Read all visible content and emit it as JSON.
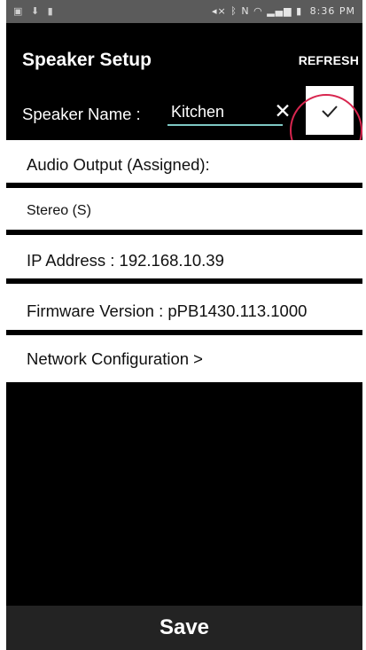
{
  "status_bar": {
    "left_icons": [
      "image-icon",
      "download-icon",
      "notification-icon"
    ],
    "right_icons": [
      "mute-icon",
      "bluetooth-icon",
      "nfc-icon",
      "wifi-icon",
      "signal-icon",
      "battery-icon"
    ],
    "time": "8:36 PM"
  },
  "header": {
    "title": "Speaker Setup",
    "refresh_label": "REFRESH"
  },
  "speaker_name": {
    "label": "Speaker Name :",
    "value": "Kitchen",
    "clear_glyph": "✕",
    "clear_icon": "close-icon",
    "confirm_icon": "checkmark-icon"
  },
  "settings": {
    "audio_output_label": "Audio Output (Assigned):",
    "audio_output_value": "Stereo (S)",
    "ip_address": "IP  Address : 192.168.10.39",
    "firmware": "Firmware  Version : pPB1430.113.1000",
    "network_config": "Network  Configuration >"
  },
  "footer": {
    "save_label": "Save"
  },
  "colors": {
    "accent_underline": "#7ec8c4",
    "highlight_ring": "#d8264f",
    "status_bar": "#5b5b5b",
    "save_bar": "#232323"
  }
}
